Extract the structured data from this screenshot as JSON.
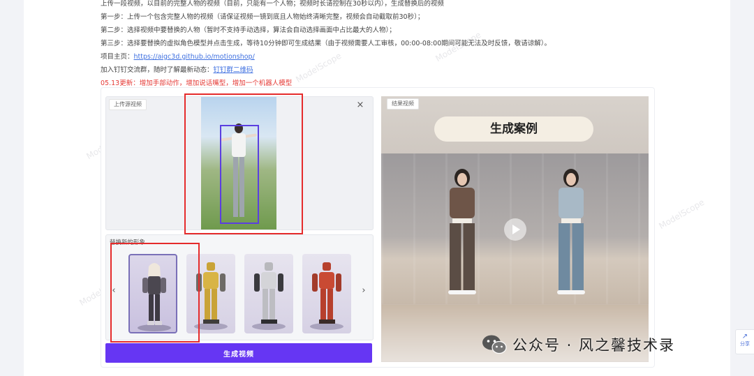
{
  "instructions": {
    "line0": "上传一段视频，以目前的完整人物的视频（目前，只能有一个人物；视频时长请控制在30秒以内），生成替换后的视频",
    "step1": "第一步：上传一个包含完整人物的视频（请保证视频一镜到底且人物始终清晰完整，视频会自动截取前30秒）；",
    "step2": "第二步：选择视频中要替换的人物（暂时不支持手动选择，算法会自动选择画面中占比最大的人物）；",
    "step3": "第三步：选择要替换的虚拟角色模型并点击生成，等待10分钟即可生成结果（由于视频需要人工审核，00:00-08:00期间可能无法及时反馈，敬请谅解）。",
    "homepage_label": "项目主页：",
    "homepage_link": "https://aigc3d.github.io/motionshop/",
    "join_label": "加入钉钉交流群，随时了解最新动态：",
    "join_link": "钉钉群二维码",
    "update": "05.13更新：增加手部动作，增加说话嘴型，增加一个机器人模型"
  },
  "upload": {
    "tag": "上传源视频",
    "close_symbol": "×"
  },
  "avatars": {
    "label": "替换新的形象",
    "prev_symbol": "‹",
    "next_symbol": "›",
    "items": [
      "girl-avatar",
      "yellow-robot-avatar",
      "silver-robot-avatar",
      "red-robot-avatar"
    ],
    "selected_index": 0
  },
  "generate_button": "生成视频",
  "result": {
    "tag": "结果视频",
    "case_title": "生成案例"
  },
  "watermark": {
    "text": "公众号 · 风之馨技术录",
    "faint": "ModelScope"
  },
  "share": {
    "icon": "↗",
    "label": "分享"
  },
  "colors": {
    "accent": "#6636f3",
    "highlight_box": "#e52b2b",
    "detect_box": "#5b3fe0",
    "link": "#3d6fe0",
    "update": "#e53935"
  }
}
